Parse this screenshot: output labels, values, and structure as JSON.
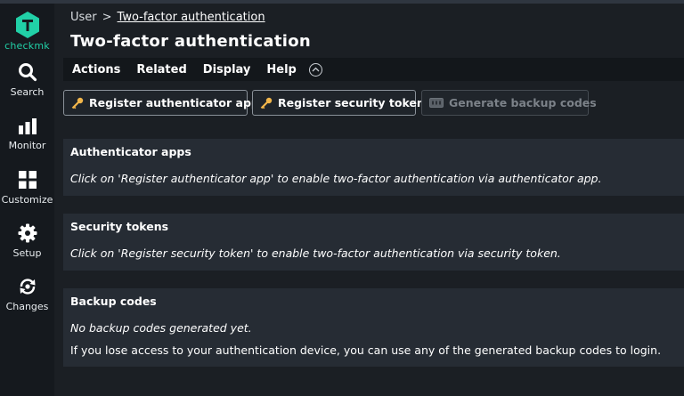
{
  "sidebar": {
    "logo_text": "checkmk",
    "items": [
      {
        "label": "Search"
      },
      {
        "label": "Monitor"
      },
      {
        "label": "Customize"
      },
      {
        "label": "Setup"
      },
      {
        "label": "Changes"
      }
    ]
  },
  "breadcrumb": {
    "root": "User",
    "separator": ">",
    "current": "Two-factor authentication"
  },
  "page_title": "Two-factor authentication",
  "menubar": {
    "items": [
      "Actions",
      "Related",
      "Display",
      "Help"
    ]
  },
  "toolbar": {
    "register_app": "Register authenticator app",
    "register_token": "Register security token",
    "generate_codes": "Generate backup codes"
  },
  "sections": {
    "apps": {
      "title": "Authenticator apps",
      "text": "Click on 'Register authenticator app' to enable two-factor authentication via authenticator app."
    },
    "tokens": {
      "title": "Security tokens",
      "text": "Click on 'Register security token' to enable two-factor authentication via security token."
    },
    "backup": {
      "title": "Backup codes",
      "text1": "No backup codes generated yet.",
      "text2": "If you lose access to your authentication device, you can use any of the generated backup codes to login."
    }
  },
  "colors": {
    "brand": "#21d0a7",
    "background": "#1b1f24",
    "panel": "#262c34",
    "key_icon": "#f2b64a"
  }
}
